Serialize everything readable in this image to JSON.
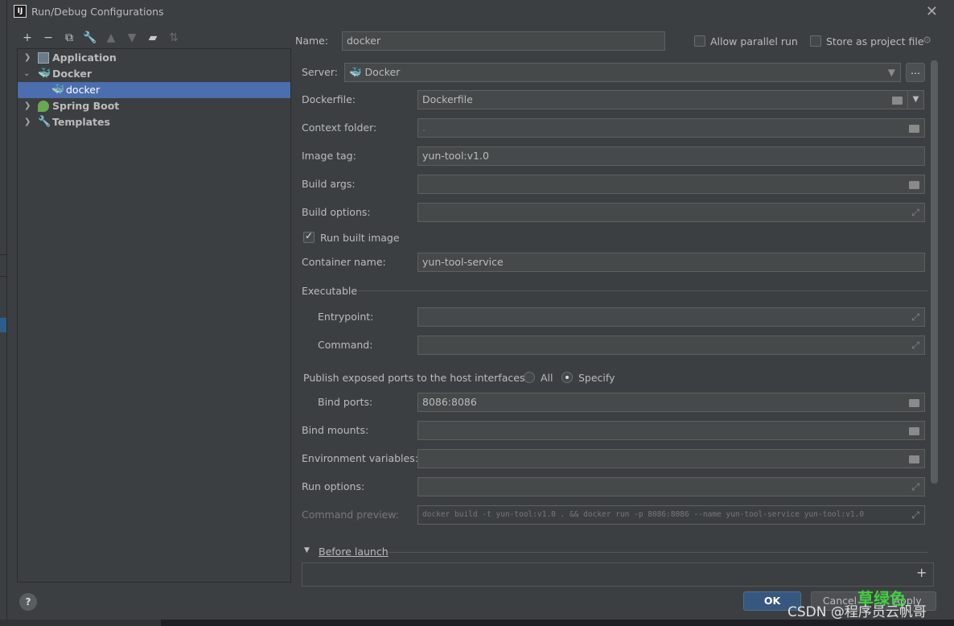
{
  "window": {
    "title": "Run/Debug Configurations",
    "app_icon": "IJ"
  },
  "tree": {
    "items": [
      {
        "label": "Application",
        "icon": "application-icon",
        "expanded": false
      },
      {
        "label": "Docker",
        "icon": "docker-icon",
        "expanded": true
      },
      {
        "label": "docker",
        "icon": "docker-icon",
        "selected": true
      },
      {
        "label": "Spring Boot",
        "icon": "spring-boot-icon",
        "expanded": false
      },
      {
        "label": "Templates",
        "icon": "wrench-icon",
        "expanded": false
      }
    ]
  },
  "form": {
    "name_label": "Name:",
    "name_value": "docker",
    "allow_parallel_label": "Allow parallel run",
    "store_project_label": "Store as project file",
    "server_label": "Server:",
    "server_value": "Docker",
    "server_more": "...",
    "dockerfile_label": "Dockerfile:",
    "dockerfile_value": "Dockerfile",
    "context_label": "Context folder:",
    "context_value": ".",
    "image_tag_label": "Image tag:",
    "image_tag_value": "yun-tool:v1.0",
    "build_args_label": "Build args:",
    "build_args_value": "",
    "build_options_label": "Build options:",
    "build_options_value": "",
    "run_built_label": "Run built image",
    "container_name_label": "Container name:",
    "container_name_value": "yun-tool-service",
    "executable_label": "Executable",
    "entrypoint_label": "Entrypoint:",
    "entrypoint_value": "",
    "command_label": "Command:",
    "command_value": "",
    "publish_label": "Publish exposed ports to the host interfaces:",
    "publish_all": "All",
    "publish_specify": "Specify",
    "bind_ports_label": "Bind ports:",
    "bind_ports_value": "8086:8086",
    "bind_mounts_label": "Bind mounts:",
    "bind_mounts_value": "",
    "env_label": "Environment variables:",
    "env_value": "",
    "run_options_label": "Run options:",
    "run_options_value": "",
    "preview_label": "Command preview:",
    "preview_value": "docker build -t yun-tool:v1.0 . && docker run -p 8086:8086 --name yun-tool-service yun-tool:v1.0",
    "before_launch_label": "Before launch"
  },
  "buttons": {
    "ok": "OK",
    "cancel": "Cancel",
    "apply": "Apply",
    "help": "?"
  },
  "watermark": {
    "green_text": "草绿色",
    "csdn": "CSDN @程序员云帆哥"
  }
}
